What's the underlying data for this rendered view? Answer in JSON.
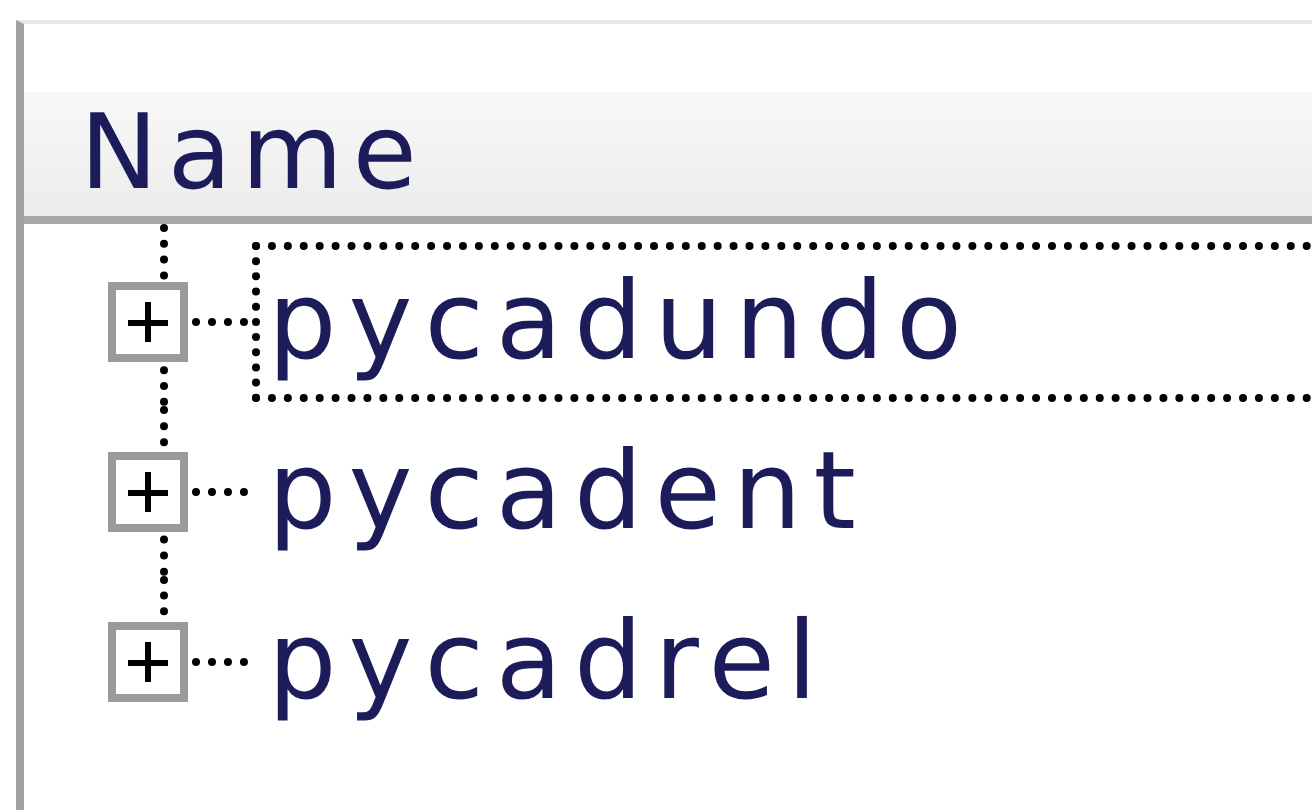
{
  "header": {
    "columns": [
      "Name"
    ]
  },
  "tree": [
    {
      "label": "pycadundo",
      "expanded": false,
      "selected": true
    },
    {
      "label": "pycadent",
      "expanded": false,
      "selected": false
    },
    {
      "label": "pycadrel",
      "expanded": false,
      "selected": false
    }
  ]
}
